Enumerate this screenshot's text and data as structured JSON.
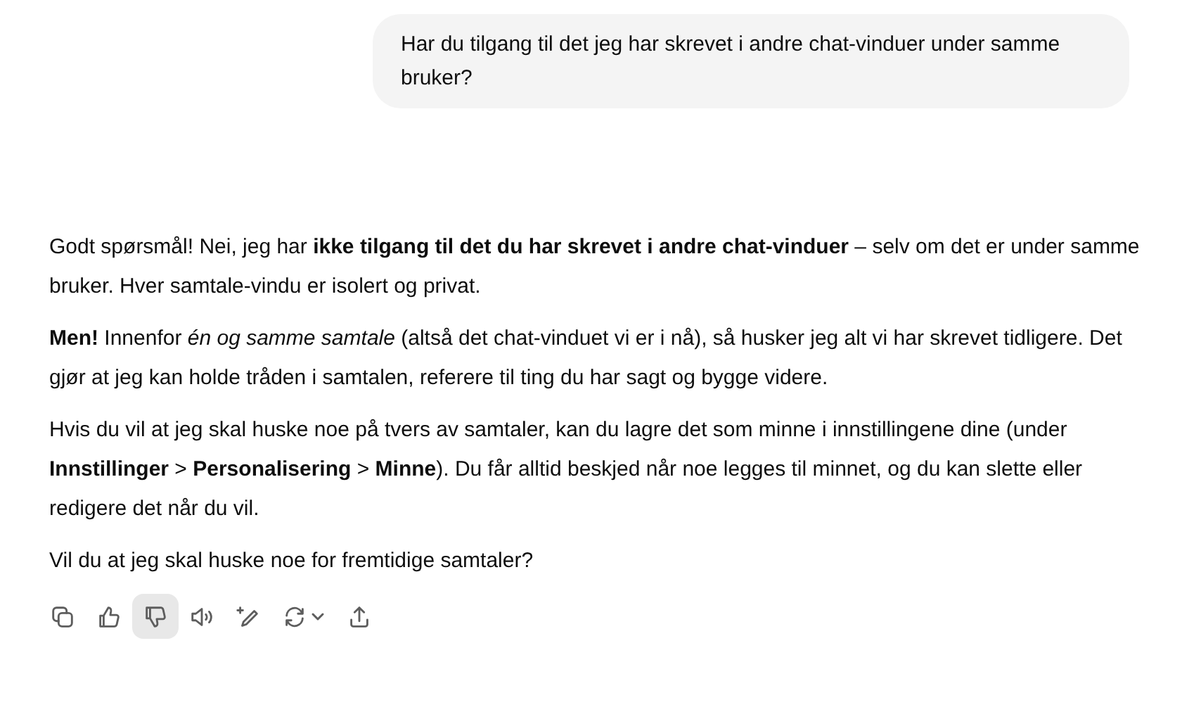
{
  "user_message": {
    "text": "Har du tilgang til det jeg har skrevet i andre chat-vinduer under samme bruker?"
  },
  "answer": {
    "paragraphs": [
      "Godt spørsmål! Nei, jeg har **ikke tilgang til det du har skrevet i andre chat-vinduer** – selv om det er under samme bruker. Hver samtale-vindu er isolert og privat.",
      "**Men!** Innenfor *én og samme samtale* (altså det chat-vinduet vi er i nå), så husker jeg alt vi har skrevet tidligere. Det gjør at jeg kan holde tråden i samtalen, referere til ting du har sagt og bygge videre.",
      "Hvis du vil at jeg skal huske noe på tvers av samtaler, kan du lagre det som minne i innstillingene dine (under **Innstillinger** > **Personalisering** > **Minne**). Du får alltid beskjed når noe legges til minnet, og du kan slette eller redigere det når du vil.",
      "Vil du at jeg skal huske noe for fremtidige samtaler?"
    ]
  },
  "actions": [
    {
      "kind": "copy",
      "hovered": false
    },
    {
      "kind": "thumbs-up",
      "hovered": false
    },
    {
      "kind": "thumbs-down",
      "hovered": true
    },
    {
      "kind": "read-aloud",
      "hovered": false
    },
    {
      "kind": "edit",
      "hovered": false
    },
    {
      "kind": "regenerate",
      "hovered": false
    },
    {
      "kind": "share",
      "hovered": false
    }
  ]
}
